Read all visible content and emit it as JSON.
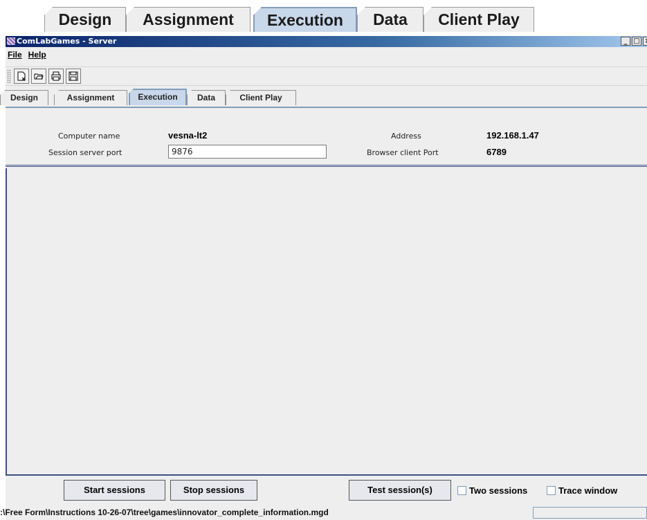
{
  "top_tabs": [
    "Design",
    "Assignment",
    "Execution",
    "Data",
    "Client Play"
  ],
  "window": {
    "title": "ComLabGames - Server",
    "controls": [
      "_",
      "□",
      "×"
    ]
  },
  "menu": {
    "file": "File",
    "help": "Help"
  },
  "toolbar": {
    "icons": [
      "new-icon",
      "open-icon",
      "print-icon",
      "save-icon"
    ]
  },
  "tabs": [
    "Design",
    "Assignment",
    "Execution",
    "Data",
    "Client Play"
  ],
  "active_tab": "Execution",
  "info": {
    "computer_name_label": "Computer name",
    "computer_name": "vesna-lt2",
    "session_port_label": "Session server port",
    "session_port": "9876",
    "address_label": "Address",
    "address": "192.168.1.47",
    "browser_port_label": "Browser client Port",
    "browser_port": "6789"
  },
  "buttons": {
    "start": "Start sessions",
    "stop": "Stop sessions",
    "test": "Test session(s)"
  },
  "checkboxes": {
    "two_sessions": {
      "label": "Two sessions",
      "checked": false
    },
    "trace_window": {
      "label": "Trace window",
      "checked": false
    }
  },
  "status": {
    "path": ":\\Free Form\\Instructions 10-26-07\\tree\\games\\innovator_complete_information.mgd"
  }
}
